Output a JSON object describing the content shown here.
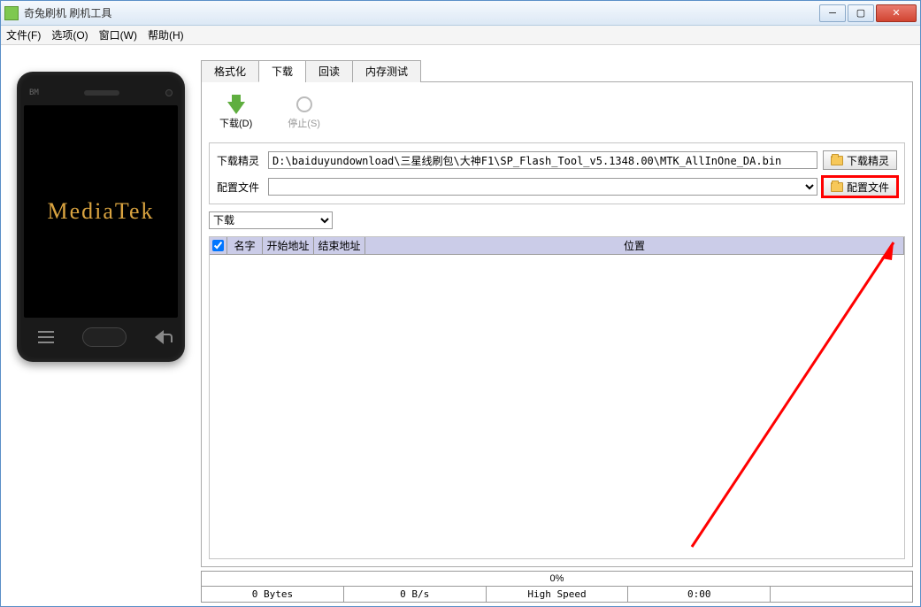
{
  "title": "奇兔刷机 刷机工具",
  "menubar": [
    "文件(F)",
    "选项(O)",
    "窗口(W)",
    "帮助(H)"
  ],
  "phone": {
    "bm_label": "BM",
    "logo": "MediaTek"
  },
  "tabs": [
    "格式化",
    "下载",
    "回读",
    "内存测试"
  ],
  "active_tab_index": 1,
  "toolbar": {
    "download": "下载(D)",
    "stop": "停止(S)"
  },
  "form": {
    "da_label": "下载精灵",
    "da_path": "D:\\baiduyundownload\\三星线刷包\\大神F1\\SP_Flash_Tool_v5.1348.00\\MTK_AllInOne_DA.bin",
    "da_browse": "下载精灵",
    "scatter_label": "配置文件",
    "scatter_path": "",
    "scatter_browse": "配置文件",
    "mode_options": [
      "下载"
    ],
    "mode_selected": "下载"
  },
  "table": {
    "columns": {
      "name": "名字",
      "start": "开始地址",
      "end": "结束地址",
      "location": "位置"
    }
  },
  "status": {
    "progress": "0%",
    "bytes": "0 Bytes",
    "speed": "0 B/s",
    "mode": "High Speed",
    "time": "0:00"
  }
}
